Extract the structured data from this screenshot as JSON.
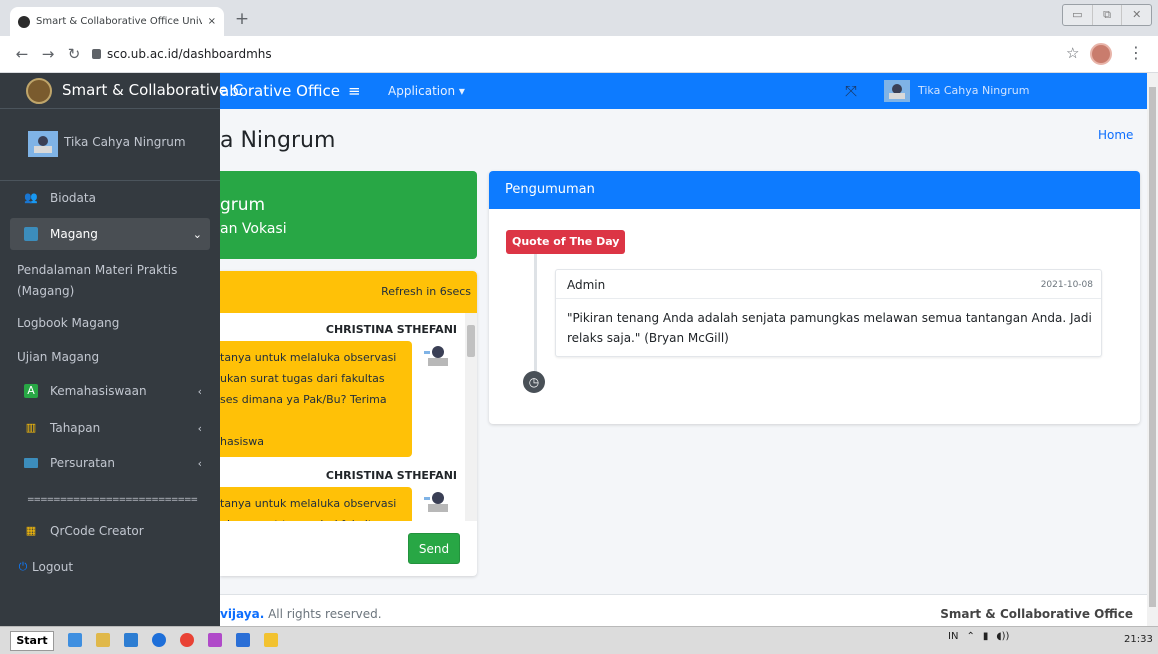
{
  "browser": {
    "tab_title": "Smart & Collaborative Office Univers",
    "tab_close": "×",
    "new_tab": "+",
    "url": "sco.ub.ac.id/dashboardmhs",
    "win_controls": [
      "▭",
      "⧉",
      "✕"
    ]
  },
  "navbar": {
    "brand_rest": "aborative Office",
    "hamburger": "≡",
    "application_menu": "Application ▾",
    "expand_icon": "⤧",
    "user_name": "Tika Cahya Ningrum"
  },
  "content": {
    "page_title": "a Ningrum",
    "breadcrumb": "Home",
    "profile_card": {
      "name_fragment": "grum",
      "faculty_fragment": "an Vokasi"
    },
    "chat": {
      "refresh": "Refresh in 6secs",
      "messages": [
        {
          "name": "CHRISTINA STHEFANI",
          "text": "tanya untuk melaluka observasi\nukan surat tugas dari fakultas\nses dimana ya Pak/Bu? Terima\n\nhasiswa"
        },
        {
          "name": "CHRISTINA STHEFANI",
          "text": "tanya untuk melaluka observasi\nukan surat tugas dari fakultas"
        }
      ],
      "send": "Send"
    },
    "announcement": {
      "title": "Pengumuman",
      "badge": "Quote of The Day",
      "author": "Admin",
      "date": "2021-10-08",
      "text": "\"Pikiran tenang Anda adalah senjata pamungkas melawan semua tantangan Anda. Jadi relaks saja.\" (Bryan McGill)"
    },
    "footer": {
      "left_link": "vijaya.",
      "left_text": " All rights reserved.",
      "right": "Smart & Collaborative Office"
    }
  },
  "sidebar": {
    "brand": "Smart & Collaborative C",
    "user": "Tika Cahya Ningrum",
    "items": {
      "biodata": "Biodata",
      "magang": "Magang",
      "sub1": "Pendalaman Materi Praktis (Magang)",
      "sub2": "Logbook Magang",
      "sub3": "Ujian Magang",
      "kemahasiswaan": "Kemahasiswaan",
      "tahapan": "Tahapan",
      "persuratan": "Persuratan",
      "divider": "==========================",
      "qrcode": "QrCode Creator",
      "logout": "Logout"
    }
  },
  "taskbar": {
    "start": "Start",
    "lang": "IN",
    "time": "21:33"
  }
}
